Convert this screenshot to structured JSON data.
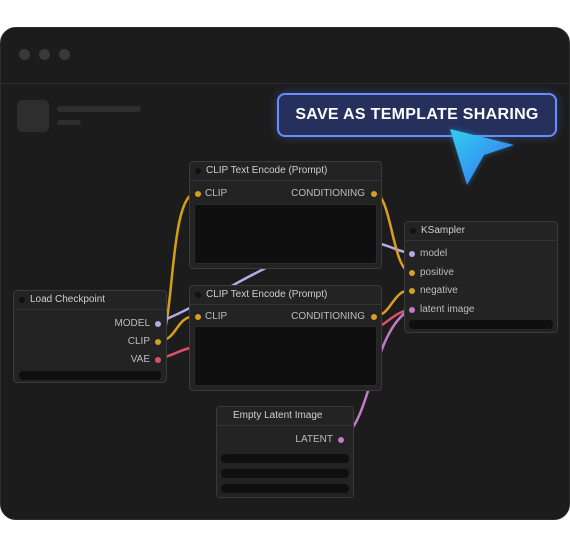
{
  "cta": {
    "label": "SAVE AS TEMPLATE SHARING"
  },
  "colors": {
    "clip_wire": "#d4a017",
    "model_wire": "#b7a9e8",
    "vae_wire": "#d9536a",
    "latent_wire": "#c07cc4",
    "conditioning_wire": "#d9a020",
    "accent": "#6a8cff"
  },
  "nodes": {
    "clip_text_top": {
      "title": "CLIP Text Encode (Prompt)",
      "input": "CLIP",
      "output": "CONDITIONING"
    },
    "clip_text_bottom": {
      "title": "CLIP Text Encode (Prompt)",
      "input": "CLIP",
      "output": "CONDITIONING"
    },
    "load_checkpoint": {
      "title": "Load Checkpoint",
      "outputs": [
        "MODEL",
        "CLIP",
        "VAE"
      ]
    },
    "ksampler": {
      "title": "KSampler",
      "inputs": [
        "model",
        "positive",
        "negative",
        "latent image"
      ]
    },
    "empty_latent": {
      "title": "Empty Latent Image",
      "output": "LATENT"
    }
  },
  "icons": {
    "cursor": "cursor-arrow-icon"
  }
}
